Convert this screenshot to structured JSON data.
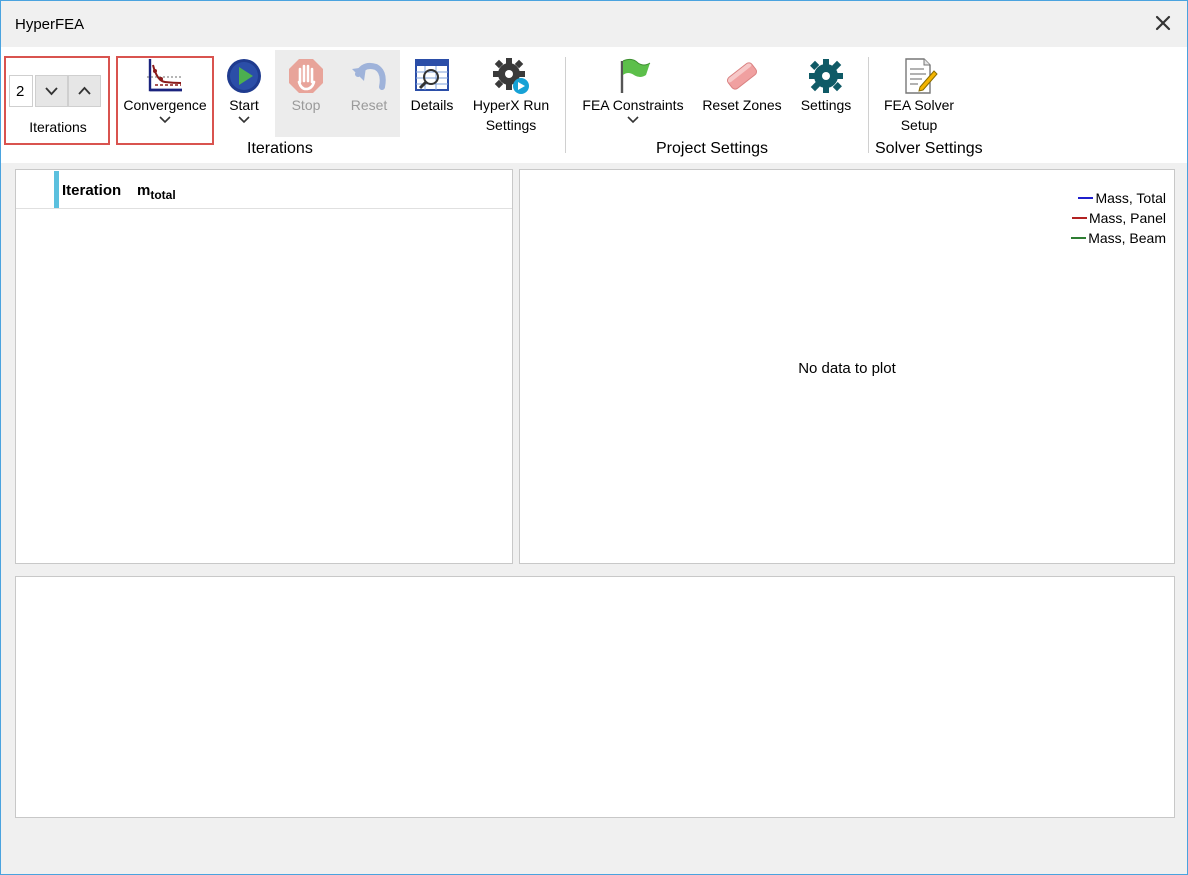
{
  "window": {
    "title": "HyperFEA"
  },
  "ribbon": {
    "iterations_spinner": {
      "value": "2",
      "label": "Iterations"
    },
    "convergence": {
      "label": "Convergence"
    },
    "start": {
      "label": "Start"
    },
    "stop": {
      "label": "Stop"
    },
    "reset": {
      "label": "Reset"
    },
    "details": {
      "label": "Details"
    },
    "hyperx_run_settings": {
      "line1": "HyperX Run",
      "line2": "Settings"
    },
    "fea_constraints": {
      "label": "FEA Constraints"
    },
    "reset_zones": {
      "label": "Reset Zones"
    },
    "settings": {
      "label": "Settings"
    },
    "fea_solver_setup": {
      "line1": "FEA Solver",
      "line2": "Setup"
    },
    "groups": {
      "iterations": "Iterations",
      "project_settings": "Project Settings",
      "solver_settings": "Solver Settings"
    }
  },
  "table": {
    "columns": [
      {
        "label": "Iteration"
      },
      {
        "label": "m",
        "subscript": "total"
      }
    ],
    "rows": []
  },
  "chart": {
    "legend": [
      {
        "label": "Mass, Total",
        "color": "#1f1fcc"
      },
      {
        "label": "Mass, Panel",
        "color": "#b22222"
      },
      {
        "label": "Mass, Beam",
        "color": "#2e7d32"
      }
    ],
    "empty_message": "No data to plot"
  },
  "chart_data": {
    "type": "line",
    "series": [
      {
        "name": "Mass, Total",
        "values": []
      },
      {
        "name": "Mass, Panel",
        "values": []
      },
      {
        "name": "Mass, Beam",
        "values": []
      }
    ],
    "legend_position": "top-right"
  },
  "colors": {
    "window_border": "#4aa3df",
    "highlight_box": "#d9534f",
    "header_accent": "#5bc0de"
  }
}
